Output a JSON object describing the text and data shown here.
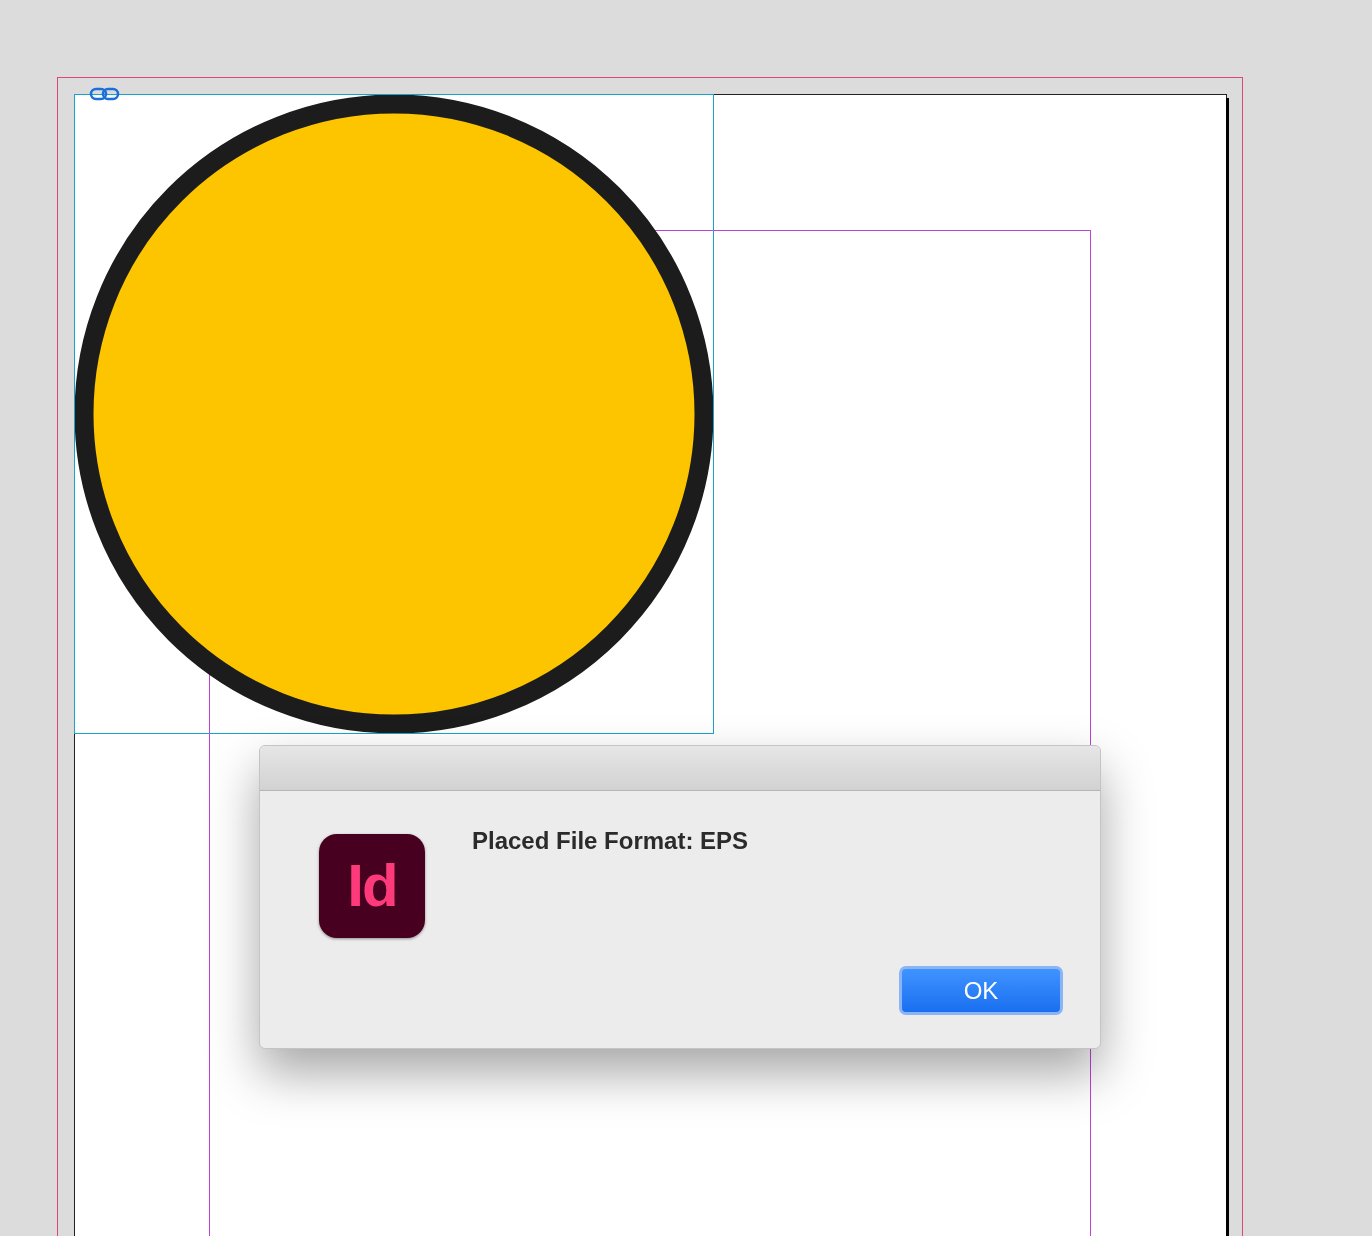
{
  "dialog": {
    "app_icon": "Id",
    "message": "Placed File Format: EPS",
    "buttons": [
      {
        "label": "OK",
        "default": true
      }
    ]
  }
}
